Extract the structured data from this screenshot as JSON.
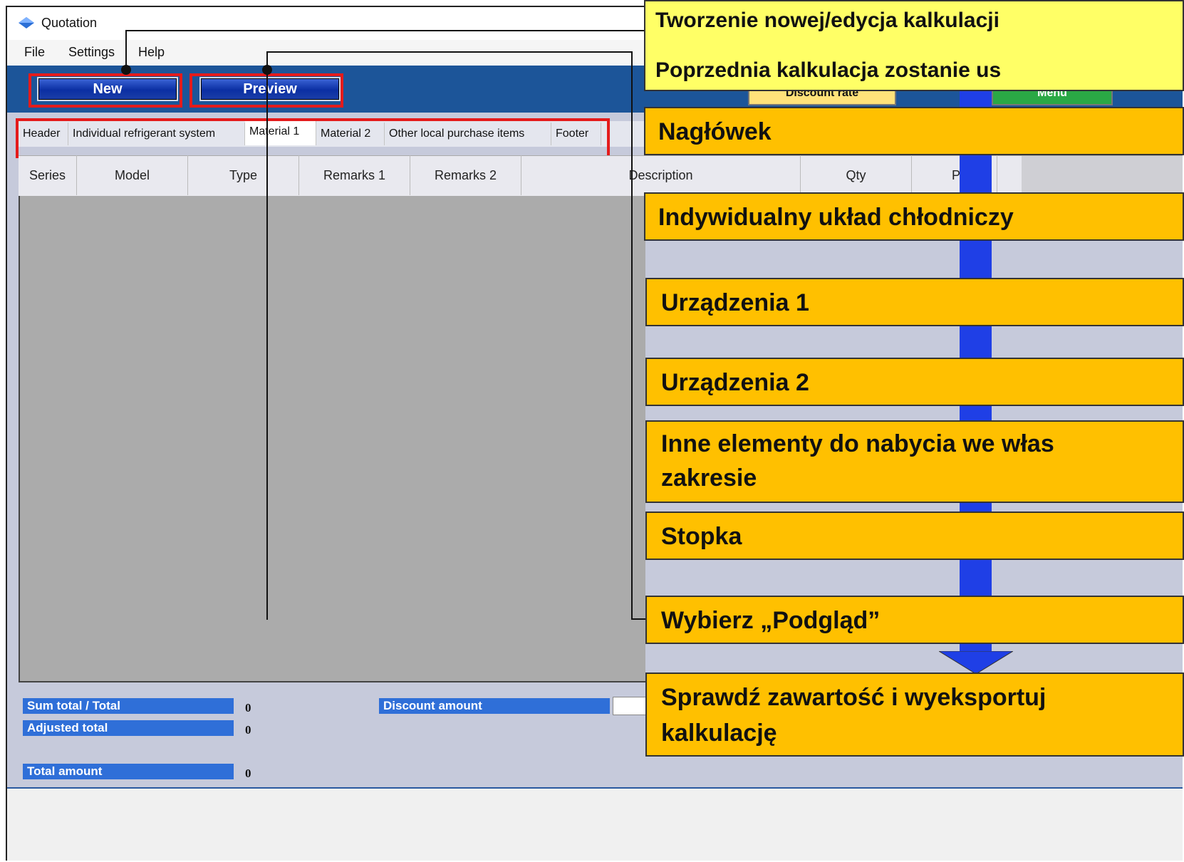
{
  "window": {
    "title": "Quotation"
  },
  "menu": {
    "file": "File",
    "settings": "Settings",
    "help": "Help"
  },
  "toolbar": {
    "new_label": "New",
    "preview_label": "Preview",
    "discount_rate_label": "Discount rate",
    "menu_label": "Menu"
  },
  "tabs": [
    {
      "label": "Header"
    },
    {
      "label": "Individual refrigerant system"
    },
    {
      "label": "Material 1"
    },
    {
      "label": "Material 2"
    },
    {
      "label": "Other local purchase items"
    },
    {
      "label": "Footer"
    }
  ],
  "active_tab": "Material 1",
  "grid": {
    "columns": [
      "Series",
      "Model",
      "Type",
      "Remarks 1",
      "Remarks 2",
      "Description",
      "Qty",
      "P"
    ]
  },
  "summary": {
    "sum_total_label": "Sum total / Total",
    "sum_total_value": "0",
    "adjusted_total_label": "Adjusted total",
    "adjusted_total_value": "0",
    "total_amount_label": "Total amount",
    "total_amount_value": "0",
    "discount_amount_label": "Discount amount"
  },
  "callouts": {
    "top_line1": "Tworzenie nowej/edycja kalkulacji",
    "top_line2": "Poprzednia kalkulacja zostanie us",
    "header": "Nagłówek",
    "individual": "Indywidualny układ chłodniczy",
    "devices1": "Urządzenia 1",
    "devices2": "Urządzenia 2",
    "other_line1": "Inne elementy do nabycia we włas",
    "other_line2": "zakresie",
    "footer": "Stopka",
    "preview": "Wybierz „Podgląd”",
    "export_line1": "Sprawdź zawartość i wyeksportuj",
    "export_line2": "kalkulację"
  },
  "colors": {
    "toolbar": "#1c5599",
    "callout": "#ffc000",
    "callout_top": "#ffff66",
    "flow_arrow": "#1f3fe6",
    "highlight": "#e41b1b",
    "summary_label": "#2f6fd8"
  }
}
